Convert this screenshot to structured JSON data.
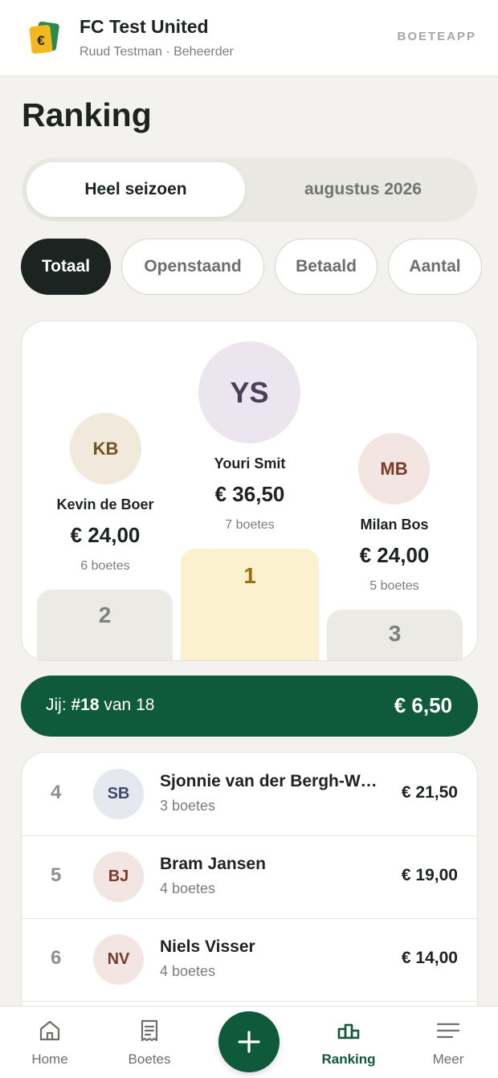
{
  "header": {
    "team_name": "FC Test United",
    "subtitle": "Ruud Testman · Beheerder",
    "brand": "BOETEAPP",
    "logo_icon": "wallet-euro-icon"
  },
  "page": {
    "title": "Ranking"
  },
  "period_tabs": [
    {
      "label": "Heel seizoen",
      "selected": true
    },
    {
      "label": "augustus 2026",
      "selected": false
    }
  ],
  "filters": [
    {
      "label": "Totaal",
      "selected": true
    },
    {
      "label": "Openstaand",
      "selected": false
    },
    {
      "label": "Betaald",
      "selected": false
    },
    {
      "label": "Aantal",
      "selected": false
    }
  ],
  "podium": {
    "first": {
      "initials": "YS",
      "name": "Youri Smit",
      "amount": "€ 36,50",
      "count": "7 boetes",
      "place": "1"
    },
    "second": {
      "initials": "KB",
      "name": "Kevin de Boer",
      "amount": "€ 24,00",
      "count": "6 boetes",
      "place": "2"
    },
    "third": {
      "initials": "MB",
      "name": "Milan Bos",
      "amount": "€ 24,00",
      "count": "5 boetes",
      "place": "3"
    }
  },
  "me": {
    "prefix": "Jij: ",
    "rank": "#18",
    "suffix": " van 18",
    "amount": "€ 6,50"
  },
  "ranking": [
    {
      "rank": "4",
      "initials": "SB",
      "name": "Sjonnie van der Bergh-Willemsen",
      "count": "3 boetes",
      "amount": "€ 21,50"
    },
    {
      "rank": "5",
      "initials": "BJ",
      "name": "Bram Jansen",
      "count": "4 boetes",
      "amount": "€ 19,00"
    },
    {
      "rank": "6",
      "initials": "NV",
      "name": "Niels Visser",
      "count": "4 boetes",
      "amount": "€ 14,00"
    }
  ],
  "nav": {
    "items": [
      {
        "label": "Home",
        "icon": "home-icon",
        "active": false
      },
      {
        "label": "Boetes",
        "icon": "receipt-icon",
        "active": false
      },
      {
        "label": "Ranking",
        "icon": "podium-icon",
        "active": true
      },
      {
        "label": "Meer",
        "icon": "menu-icon",
        "active": false
      }
    ],
    "fab_icon": "plus-icon"
  },
  "colors": {
    "primary": "#0f5a3b",
    "dark": "#1b2420",
    "background": "#f3f2ee",
    "gold_block": "#fcf1cf",
    "gold_text": "#9a6e0a"
  }
}
